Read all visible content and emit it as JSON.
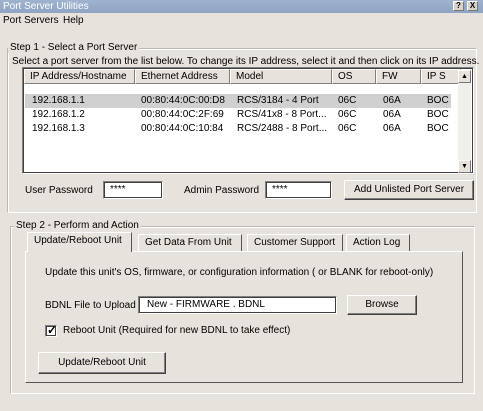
{
  "window": {
    "title": "Port Server Utilities",
    "help_button": "?",
    "close_button": "X"
  },
  "menu": {
    "items": [
      "Port Servers",
      "Help"
    ]
  },
  "step1": {
    "legend": "Step 1 - Select a Port Server",
    "instructions": "Select a port server from the list below.  To change its IP address, select it and then click on its IP address.",
    "columns": [
      "IP Address/Hostname",
      "Ethernet Address",
      "Model",
      "OS",
      "FW",
      "IP S"
    ],
    "rows": [
      {
        "ip": "192.168.1.1",
        "eth": "00:80:44:0C:00:D8",
        "model": "RCS/3184 - 4 Port",
        "os": "06C",
        "fw": "06A",
        "ips": "BOC"
      },
      {
        "ip": "192.168.1.2",
        "eth": "00:80:44:0C:2F:69",
        "model": "RCS/41x8 - 8 Port...",
        "os": "06C",
        "fw": "06A",
        "ips": "BOC"
      },
      {
        "ip": "192.168.1.3",
        "eth": "00:80:44:0C:10:84",
        "model": "RCS/2488 - 8 Port...",
        "os": "06C",
        "fw": "06A",
        "ips": "BOC"
      }
    ],
    "selected_row": 0,
    "user_password_label": "User Password",
    "user_password_value": "****",
    "admin_password_label": "Admin Password",
    "admin_password_value": "****",
    "add_button": "Add Unlisted Port Server"
  },
  "step2": {
    "legend": "Step 2 - Perform and Action",
    "tabs": [
      "Update/Reboot Unit",
      "Get Data From Unit",
      "Customer Support",
      "Action Log"
    ],
    "active_tab": 0,
    "description": "Update this unit's OS, firmware, or configuration information ( or BLANK for reboot-only)",
    "bdnl_label": "BDNL File to Upload",
    "bdnl_value": "New - FIRMWARE . BDNL",
    "browse_button": "Browse",
    "reboot_label": "Reboot Unit (Required for new BDNL to take effect)",
    "reboot_checked": true,
    "update_button": "Update/Reboot Unit"
  },
  "icons": {
    "scroll_up": "scroll-up-icon",
    "scroll_down": "scroll-down-icon",
    "checkmark": "checkmark-icon"
  }
}
